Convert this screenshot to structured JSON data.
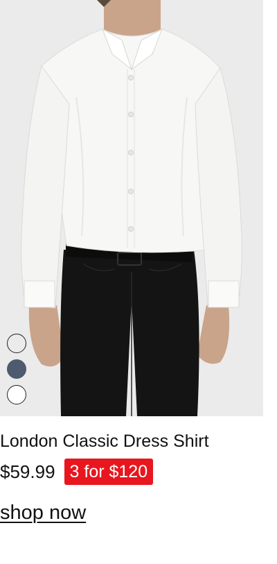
{
  "product": {
    "image_description_icon": "model-wearing-shirt-image",
    "title": "London Classic Dress Shirt",
    "price": "$59.99",
    "promo": "3 for $120",
    "cta_label": "shop now"
  },
  "swatches": [
    {
      "name": "light-grey",
      "color": "#ebebeb",
      "selected": true
    },
    {
      "name": "slate-blue",
      "color": "#4e5a6e",
      "selected": false
    },
    {
      "name": "white",
      "color": "#ffffff",
      "selected": false
    }
  ],
  "colors": {
    "promo_background": "#e8161e",
    "image_background": "#ebebeb",
    "text": "#111111"
  }
}
